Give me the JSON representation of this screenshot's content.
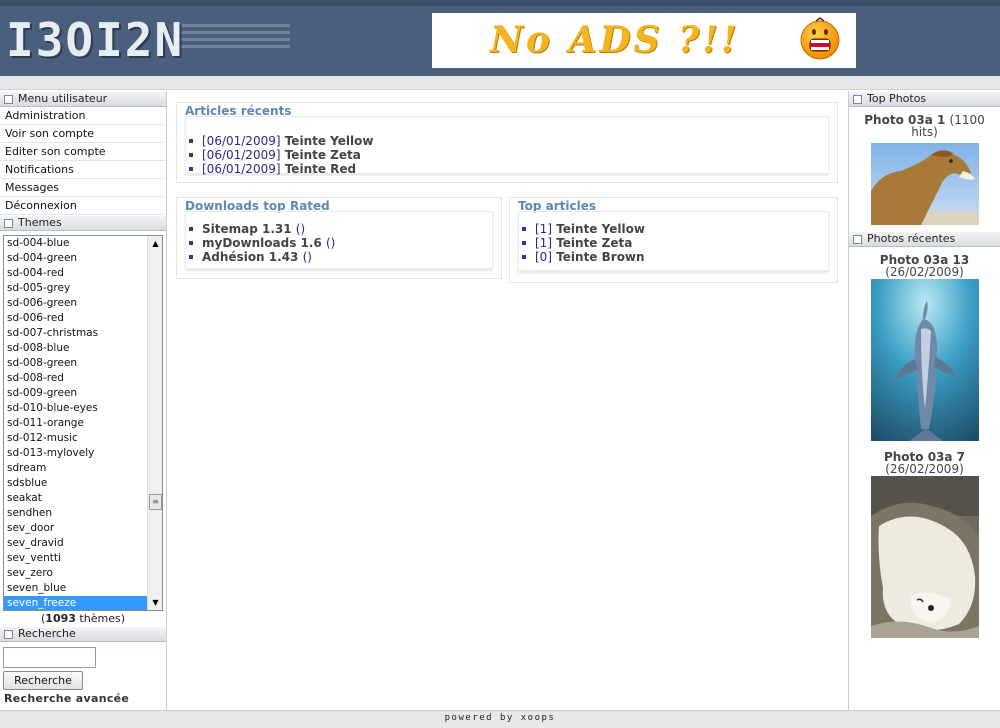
{
  "header": {
    "logo_text": "I3OI2N",
    "banner_text": "No ADS ?!!"
  },
  "user_menu": {
    "title": "Menu utilisateur",
    "items": [
      "Administration",
      "Voir son compte",
      "Editer son compte",
      "Notifications",
      "Messages",
      "Déconnexion"
    ]
  },
  "themes": {
    "title": "Themes",
    "options": [
      "sd-004-blue",
      "sd-004-green",
      "sd-004-red",
      "sd-005-grey",
      "sd-006-green",
      "sd-006-red",
      "sd-007-christmas",
      "sd-008-blue",
      "sd-008-green",
      "sd-008-red",
      "sd-009-green",
      "sd-010-blue-eyes",
      "sd-011-orange",
      "sd-012-music",
      "sd-013-mylovely",
      "sdream",
      "sdsblue",
      "seakat",
      "sendhen",
      "sev_door",
      "sev_dravid",
      "sev_ventti",
      "sev_zero",
      "seven_blue",
      "seven_freeze"
    ],
    "selected": "seven_freeze",
    "count": "1093",
    "count_suffix": "thèmes",
    "count_open": "(",
    "count_close": ")"
  },
  "search": {
    "title": "Recherche",
    "input_value": "",
    "button_label": "Recherche",
    "advanced_link": "Recherche avancée"
  },
  "recent_articles": {
    "title": "Articles récents",
    "items": [
      {
        "date": "[06/01/2009]",
        "label": "Teinte Yellow"
      },
      {
        "date": "[06/01/2009]",
        "label": "Teinte Zeta"
      },
      {
        "date": "[06/01/2009]",
        "label": "Teinte Red"
      }
    ]
  },
  "downloads_top": {
    "title": "Downloads top Rated",
    "items": [
      {
        "label": "Sitemap 1.31",
        "extra": "()"
      },
      {
        "label": "myDownloads 1.6",
        "extra": "()"
      },
      {
        "label": "Adhésion 1.43",
        "extra": "()"
      }
    ]
  },
  "top_articles": {
    "title": "Top articles",
    "items": [
      {
        "rank": "[1]",
        "label": "Teinte Yellow"
      },
      {
        "rank": "[1]",
        "label": "Teinte Zeta"
      },
      {
        "rank": "[0]",
        "label": "Teinte Brown"
      }
    ]
  },
  "top_photos": {
    "title": "Top Photos",
    "photo": {
      "caption_bold": "Photo 03a 1",
      "caption_extra": "(1100 hits)"
    }
  },
  "recent_photos": {
    "title": "Photos récentes",
    "photos": [
      {
        "caption_bold": "Photo 03a 13",
        "caption_extra": "(26/02/2009)"
      },
      {
        "caption_bold": "Photo 03a 7",
        "caption_extra": "(26/02/2009)"
      }
    ]
  },
  "footer": {
    "text": "powered by xoops"
  }
}
